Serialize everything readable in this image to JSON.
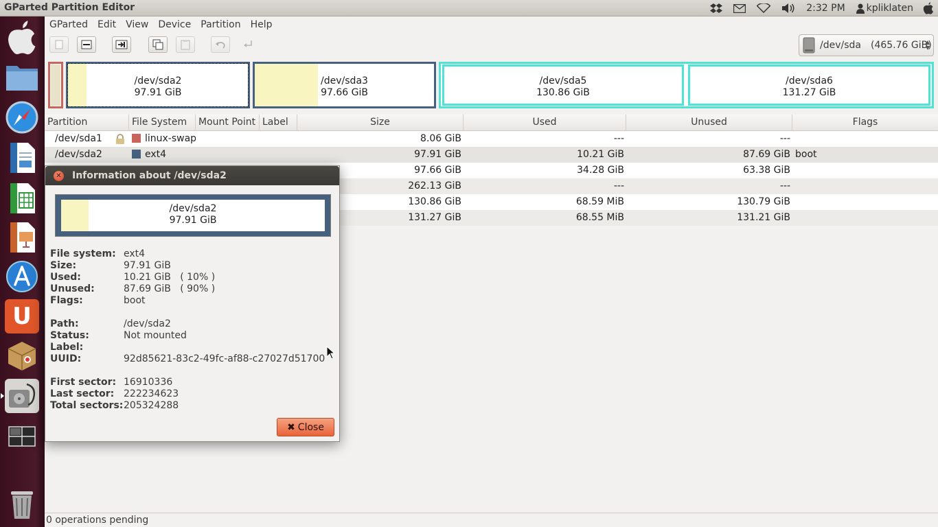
{
  "top_panel": {
    "title": "GParted Partition Editor",
    "clock": "2:32 PM",
    "user": "kpliklaten",
    "icons": [
      "dropbox-icon",
      "mail-icon",
      "wifi-icon",
      "volume-icon",
      "user-icon",
      "apple-icon"
    ]
  },
  "menubar": {
    "items": [
      "GParted",
      "Edit",
      "View",
      "Device",
      "Partition",
      "Help"
    ]
  },
  "toolbar": {
    "device_name": "/dev/sda",
    "device_size": "(465.76 GiB)"
  },
  "diskmap": {
    "partitions": [
      {
        "name": "/dev/sda2",
        "size": "97.91 GiB"
      },
      {
        "name": "/dev/sda3",
        "size": "97.66 GiB"
      },
      {
        "name": "/dev/sda5",
        "size": "130.86 GiB"
      },
      {
        "name": "/dev/sda6",
        "size": "131.27 GiB"
      }
    ],
    "colors": {
      "swap": "#c9655a",
      "ext4": "#45617f",
      "extended": "#4fe3d4",
      "used": "#f8f5c0"
    }
  },
  "table": {
    "headers": [
      "Partition",
      "File System",
      "Mount Point",
      "Label",
      "Size",
      "Used",
      "Unused",
      "Flags"
    ],
    "rows": [
      {
        "partition": "/dev/sda1",
        "fs": "linux-swap",
        "fs_color": "#c9655a",
        "size": "8.06 GiB",
        "used": "---",
        "unused": "---",
        "flags": ""
      },
      {
        "partition": "/dev/sda2",
        "fs": "ext4",
        "fs_color": "#45617f",
        "size": "97.91 GiB",
        "used": "10.21 GiB",
        "unused": "87.69 GiB",
        "flags": "boot"
      },
      {
        "partition": "",
        "fs": "",
        "fs_color": "",
        "size": "97.66 GiB",
        "used": "34.28 GiB",
        "unused": "63.38 GiB",
        "flags": ""
      },
      {
        "partition": "",
        "fs": "",
        "fs_color": "",
        "size": "262.13 GiB",
        "used": "---",
        "unused": "---",
        "flags": ""
      },
      {
        "partition": "",
        "fs": "",
        "fs_color": "",
        "size": "130.86 GiB",
        "used": "68.59 MiB",
        "unused": "130.79 GiB",
        "flags": ""
      },
      {
        "partition": "",
        "fs": "",
        "fs_color": "",
        "size": "131.27 GiB",
        "used": "68.55 MiB",
        "unused": "131.21 GiB",
        "flags": ""
      }
    ]
  },
  "statusbar": {
    "text": "0 operations pending"
  },
  "dialog": {
    "title": "Information about /dev/sda2",
    "map": {
      "name": "/dev/sda2",
      "size": "97.91 GiB"
    },
    "fields": [
      {
        "label": "File system:",
        "value": "ext4"
      },
      {
        "label": "Size:",
        "value": "97.91 GiB"
      },
      {
        "label": "Used:",
        "value": "10.21 GiB   ( 10% )"
      },
      {
        "label": "Unused:",
        "value": "87.69 GiB   ( 90% )"
      },
      {
        "label": "Flags:",
        "value": "boot"
      },
      {
        "label": "Path:",
        "value": "/dev/sda2"
      },
      {
        "label": "Status:",
        "value": "Not mounted"
      },
      {
        "label": "Label:",
        "value": ""
      },
      {
        "label": "UUID:",
        "value": "92d85621-83c2-49fc-af88-c27027d51700"
      },
      {
        "label": "First sector:",
        "value": "16910336"
      },
      {
        "label": "Last sector:",
        "value": "222234623"
      },
      {
        "label": "Total sectors:",
        "value": "205324288"
      }
    ],
    "close_label": "Close"
  }
}
